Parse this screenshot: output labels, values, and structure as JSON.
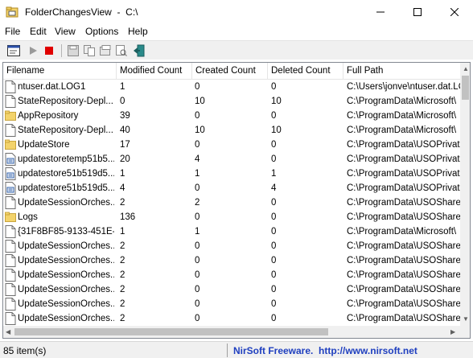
{
  "window": {
    "title": "FolderChangesView  -  C:\\",
    "minimize_icon": "minimize-icon",
    "maximize_icon": "maximize-icon",
    "close_icon": "close-icon"
  },
  "menu": [
    "File",
    "Edit",
    "View",
    "Options",
    "Help"
  ],
  "toolbar": [
    "properties-icon",
    "play-icon",
    "stop-icon",
    "save-icon",
    "copy-icon",
    "html-report-icon",
    "find-icon",
    "exit-icon"
  ],
  "columns": {
    "filename": "Filename",
    "modified": "Modified Count",
    "created": "Created Count",
    "deleted": "Deleted Count",
    "path": "Full Path"
  },
  "rows": [
    {
      "type": "file",
      "name": "ntuser.dat.LOG1",
      "modified": "1",
      "created": "0",
      "deleted": "0",
      "path": "C:\\Users\\jonve\\ntuser.dat.LO"
    },
    {
      "type": "file",
      "name": "StateRepository-Depl...",
      "modified": "0",
      "created": "10",
      "deleted": "10",
      "path": "C:\\ProgramData\\Microsoft\\"
    },
    {
      "type": "folder",
      "name": "AppRepository",
      "modified": "39",
      "created": "0",
      "deleted": "0",
      "path": "C:\\ProgramData\\Microsoft\\"
    },
    {
      "type": "file",
      "name": "StateRepository-Depl...",
      "modified": "40",
      "created": "10",
      "deleted": "10",
      "path": "C:\\ProgramData\\Microsoft\\"
    },
    {
      "type": "folder",
      "name": "UpdateStore",
      "modified": "17",
      "created": "0",
      "deleted": "0",
      "path": "C:\\ProgramData\\USOPrivate"
    },
    {
      "type": "xml",
      "name": "updatestoretemp51b5...",
      "modified": "20",
      "created": "4",
      "deleted": "0",
      "path": "C:\\ProgramData\\USOPrivate"
    },
    {
      "type": "xml",
      "name": "updatestore51b519d5...",
      "modified": "1",
      "created": "1",
      "deleted": "1",
      "path": "C:\\ProgramData\\USOPrivate"
    },
    {
      "type": "xml",
      "name": "updatestore51b519d5...",
      "modified": "4",
      "created": "0",
      "deleted": "4",
      "path": "C:\\ProgramData\\USOPrivate"
    },
    {
      "type": "file",
      "name": "UpdateSessionOrches...",
      "modified": "2",
      "created": "2",
      "deleted": "0",
      "path": "C:\\ProgramData\\USOShared"
    },
    {
      "type": "folder",
      "name": "Logs",
      "modified": "136",
      "created": "0",
      "deleted": "0",
      "path": "C:\\ProgramData\\USOShared"
    },
    {
      "type": "file",
      "name": "{31F8BF85-9133-451E-...",
      "modified": "1",
      "created": "1",
      "deleted": "0",
      "path": "C:\\ProgramData\\Microsoft\\"
    },
    {
      "type": "file",
      "name": "UpdateSessionOrches...",
      "modified": "2",
      "created": "0",
      "deleted": "0",
      "path": "C:\\ProgramData\\USOShared"
    },
    {
      "type": "file",
      "name": "UpdateSessionOrches...",
      "modified": "2",
      "created": "0",
      "deleted": "0",
      "path": "C:\\ProgramData\\USOShared"
    },
    {
      "type": "file",
      "name": "UpdateSessionOrches...",
      "modified": "2",
      "created": "0",
      "deleted": "0",
      "path": "C:\\ProgramData\\USOShared"
    },
    {
      "type": "file",
      "name": "UpdateSessionOrches...",
      "modified": "2",
      "created": "0",
      "deleted": "0",
      "path": "C:\\ProgramData\\USOShared"
    },
    {
      "type": "file",
      "name": "UpdateSessionOrches...",
      "modified": "2",
      "created": "0",
      "deleted": "0",
      "path": "C:\\ProgramData\\USOShared"
    },
    {
      "type": "file",
      "name": "UpdateSessionOrches...",
      "modified": "2",
      "created": "0",
      "deleted": "0",
      "path": "C:\\ProgramData\\USOShared"
    }
  ],
  "status": {
    "count": "85 item(s)",
    "promo": "NirSoft Freeware.  http://www.nirsoft.net"
  },
  "colors": {
    "folder": "#f3d36b",
    "stop": "#e00000",
    "link": "#1f3fbf"
  }
}
